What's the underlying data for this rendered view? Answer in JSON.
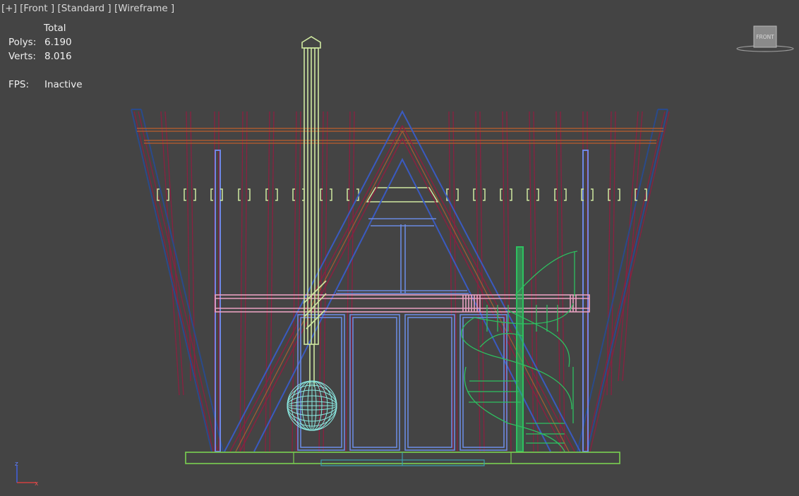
{
  "viewport": {
    "menu_plus": "[+]",
    "view_name": "[Front ]",
    "shading_mode": "[Standard ]",
    "display_mode": "[Wireframe ]"
  },
  "stats": {
    "header": "Total",
    "polys_label": "Polys:",
    "polys_value": "6.190",
    "verts_label": "Verts:",
    "verts_value": "8.016",
    "fps_label": "FPS:",
    "fps_value": "Inactive"
  },
  "viewcube": {
    "face_label": "FRONT"
  },
  "axis": {
    "z_label": "z",
    "x_label": "x"
  },
  "colors": {
    "background": "#444444",
    "roof_frame_blue": "#2a4a8a",
    "rafters_red": "#8a2040",
    "posts_blue": "#6f86e6",
    "chimney_yellow": "#cfe8a0",
    "deck_pink": "#e8a0c0",
    "stairs_green": "#2ec060",
    "base_green": "#7ad050",
    "glass_blue": "#6a8ae0",
    "sphere_cyan": "#8ae8e0"
  }
}
